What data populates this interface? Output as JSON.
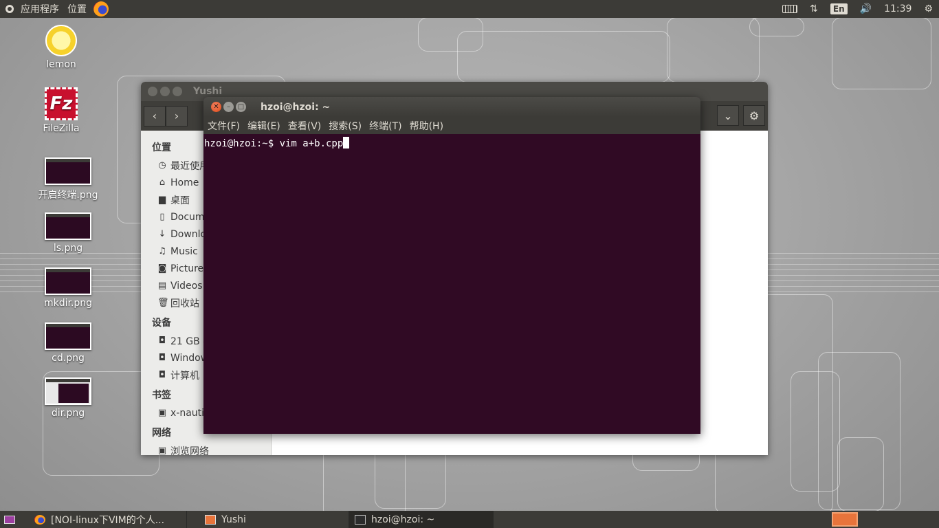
{
  "top_panel": {
    "applications": "应用程序",
    "places": "位置",
    "language": "En",
    "time": "11:39",
    "icons": [
      "keyboard-icon",
      "network-icon",
      "volume-icon",
      "settings-icon"
    ]
  },
  "desktop": {
    "icons": [
      {
        "label": "lemon",
        "icon": "lemon-icon"
      },
      {
        "label": "FileZilla",
        "icon": "filezilla-icon",
        "glyph": "Fz"
      },
      {
        "label": "开启终端.png",
        "icon": "image-thumbnail"
      },
      {
        "label": "ls.png",
        "icon": "image-thumbnail"
      },
      {
        "label": "mkdir.png",
        "icon": "image-thumbnail"
      },
      {
        "label": "cd.png",
        "icon": "image-thumbnail"
      },
      {
        "label": "dir.png",
        "icon": "image-thumbnail"
      }
    ]
  },
  "files_window": {
    "title": "Yushi",
    "sidebar": {
      "places_heading": "位置",
      "places": [
        "最近使用",
        "Home",
        "桌面",
        "Documents",
        "Downloads",
        "Music",
        "Pictures",
        "Videos",
        "回收站"
      ],
      "devices_heading": "设备",
      "devices": [
        "21 GB 卷",
        "Windows",
        "计算机"
      ],
      "bookmarks_heading": "书签",
      "bookmarks": [
        "x-nautilus-desktop"
      ],
      "network_heading": "网络",
      "network": [
        "浏览网络"
      ]
    }
  },
  "terminal": {
    "title": "hzoi@hzoi: ~",
    "menu": [
      "文件(F)",
      "编辑(E)",
      "查看(V)",
      "搜索(S)",
      "终端(T)",
      "帮助(H)"
    ],
    "prompt": "hzoi@hzoi:~$ ",
    "command": "vim a+b.cpp"
  },
  "taskbar": {
    "tasks": [
      {
        "label": "[NOI-linux下VIM的个人...",
        "icon": "firefox-icon"
      },
      {
        "label": "Yushi",
        "icon": "file-manager-icon"
      },
      {
        "label": "hzoi@hzoi: ~",
        "icon": "terminal-icon"
      }
    ]
  },
  "colors": {
    "panel": "#3c3b37",
    "terminal_bg": "#300a24",
    "accent": "#e8743b"
  }
}
